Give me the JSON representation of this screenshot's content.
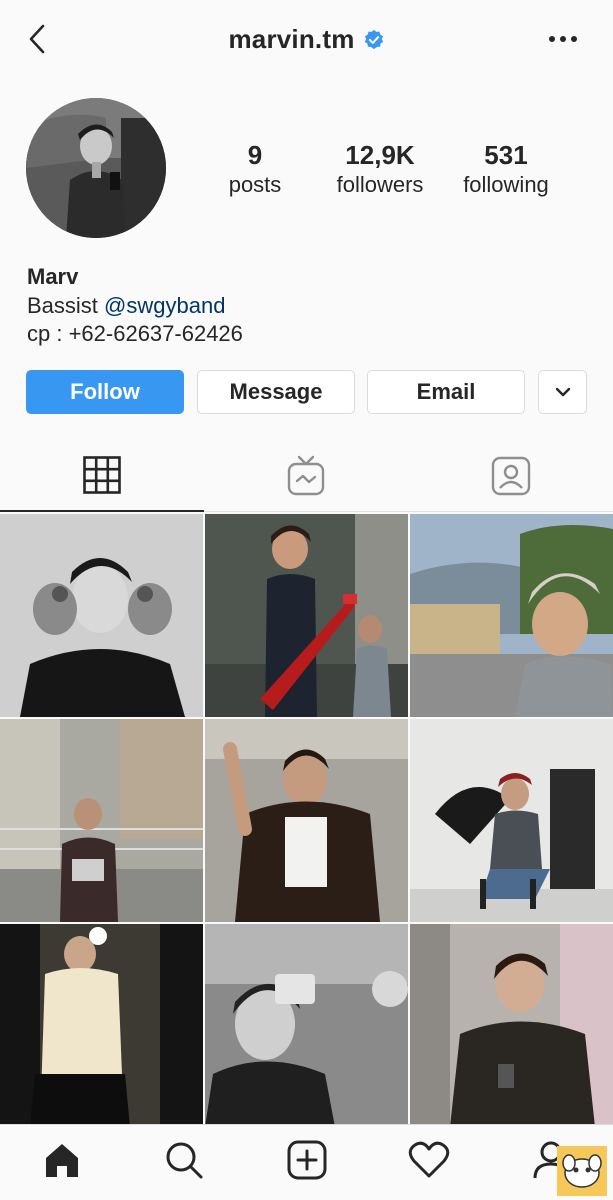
{
  "header": {
    "username": "marvin.tm",
    "verified": true,
    "back_icon": "chevron-left-icon",
    "more_icon": "more-horizontal-icon"
  },
  "stats": {
    "posts_count": "9",
    "posts_label": "posts",
    "followers_count": "12,9K",
    "followers_label": "followers",
    "following_count": "531",
    "following_label": "following"
  },
  "bio": {
    "name": "Marv",
    "role": "Bassist",
    "mention": "@swgyband",
    "contact": "cp : +62-62637-62426"
  },
  "actions": {
    "follow_label": "Follow",
    "message_label": "Message",
    "email_label": "Email",
    "more_icon": "chevron-down-icon"
  },
  "tabs": [
    {
      "name": "grid",
      "icon": "grid-icon",
      "active": true
    },
    {
      "name": "igtv",
      "icon": "igtv-icon",
      "active": false
    },
    {
      "name": "tagged",
      "icon": "tagged-user-icon",
      "active": false
    }
  ],
  "bottom_nav": [
    {
      "name": "home",
      "icon": "home-icon"
    },
    {
      "name": "search",
      "icon": "search-icon"
    },
    {
      "name": "new-post",
      "icon": "add-post-icon"
    },
    {
      "name": "activity",
      "icon": "heart-icon"
    },
    {
      "name": "profile",
      "icon": "profile-icon"
    }
  ],
  "colors": {
    "accent": "#3897f0",
    "verified": "#3897f0",
    "mention": "#003569",
    "text": "#262626",
    "border": "#dbdbdb",
    "background": "#fafafa"
  }
}
